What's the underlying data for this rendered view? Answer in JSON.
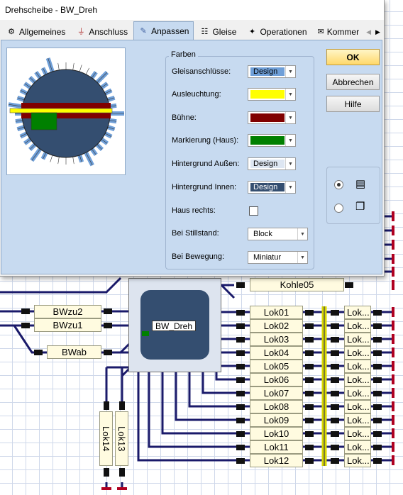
{
  "window": {
    "title": "Drehscheibe - BW_Dreh"
  },
  "tabs": [
    {
      "label": "Allgemeines",
      "icon": "gear-icon"
    },
    {
      "label": "Anschluss",
      "icon": "plug-icon"
    },
    {
      "label": "Anpassen",
      "icon": "brush-icon",
      "active": true
    },
    {
      "label": "Gleise",
      "icon": "tracks-icon"
    },
    {
      "label": "Operationen",
      "icon": "operations-icon"
    },
    {
      "label": "Kommer",
      "icon": "comment-icon"
    }
  ],
  "farben": {
    "title": "Farben",
    "rows": [
      {
        "label": "Gleisanschlüsse:",
        "value": "Design",
        "color": "#6f9fd8"
      },
      {
        "label": "Ausleuchtung:",
        "value": "",
        "color": "#ffff00"
      },
      {
        "label": "Bühne:",
        "value": "",
        "color": "#800000"
      },
      {
        "label": "Markierung (Haus):",
        "value": "",
        "color": "#008000"
      },
      {
        "label": "Hintergrund Außen:",
        "value": "Design",
        "color": "#dde6f2"
      },
      {
        "label": "Hintergrund Innen:",
        "value": "Design",
        "color": "#344e70"
      }
    ],
    "haus_rechts_label": "Haus rechts:",
    "haus_rechts_checked": false,
    "stillstand_label": "Bei Stillstand:",
    "stillstand_value": "Block",
    "bewegung_label": "Bei Bewegung:",
    "bewegung_value": "Miniatur"
  },
  "buttons": {
    "ok": "OK",
    "cancel": "Abbrechen",
    "help": "Hilfe"
  },
  "view_mode": {
    "selected": "detail"
  },
  "layout": {
    "kohle": "Kohle05",
    "turntable": "BW_Dreh",
    "left_blocks": [
      "BWzu2",
      "BWzu1",
      "BWab"
    ],
    "vertical_blocks": [
      "Lok14",
      "Lok13"
    ],
    "lok_blocks": [
      "Lok01",
      "Lok02",
      "Lok03",
      "Lok04",
      "Lok05",
      "Lok06",
      "Lok07",
      "Lok08",
      "Lok09",
      "Lok10",
      "Lok11",
      "Lok12"
    ],
    "lok_short": "Lok..."
  },
  "colors": {
    "track": "#1a1a6a",
    "signal_red": "#b00020",
    "signal_yellow": "#ffff00",
    "block_bg": "#fffbe0"
  }
}
